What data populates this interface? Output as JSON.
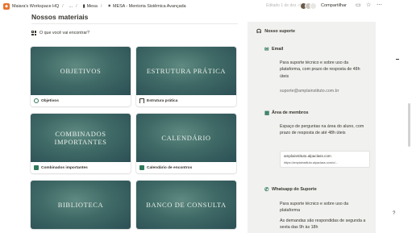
{
  "topbar": {
    "workspace_icon": "notion-workspace-icon",
    "workspace": "Maiara's Workspace HQ",
    "ellipsis": "...",
    "crumb_mesa": "Mesa",
    "crumb_mentoria": "MESA - Mentoria Sistêmica Avançada",
    "edit_info": "Editado 1 de dez. de 2024",
    "share": "Compartilhar",
    "icons": [
      "comment-icon",
      "star-icon",
      "more-icon"
    ]
  },
  "page": {
    "title": "Nossos materiais",
    "search_prompt": "O que você vai encontrar?"
  },
  "cards": [
    {
      "cover": "OBJETIVOS",
      "label": "Objetivos",
      "icon": "target-icon",
      "icon_color": "#2f7a5c"
    },
    {
      "cover": "ESTRUTURA PRÁTICA",
      "label": "Estrutura prática",
      "icon": "hierarchy-icon",
      "icon_color": "#37352f"
    },
    {
      "cover": "COMBINADOS IMPORTANTES",
      "label": "Combinados importantes",
      "icon": "flag-icon",
      "icon_color": "#2f7a5c"
    },
    {
      "cover": "CALENDÁRIO",
      "label": "Calendário de encontros",
      "icon": "calendar-icon",
      "icon_color": "#2f7a5c"
    },
    {
      "cover": "BIBLIOTECA",
      "label": "",
      "icon": "",
      "icon_color": "#2f7a5c"
    },
    {
      "cover": "BANCO DE CONSULTA",
      "label": "",
      "icon": "",
      "icon_color": "#2f7a5c"
    }
  ],
  "support": {
    "title": "Nosso suporte",
    "email": {
      "heading": "Email",
      "text": "Para suporte técnico e sobre uso da plataforma, com prazo de resposta de 48h úteis",
      "address": "suporte@amplainstituto.com.br"
    },
    "members": {
      "heading": "Área de membros",
      "text": "Espaço de perguntas na área do aluno, com prazo de resposta de até 48h úteis",
      "link_title": "amplainstituto.alpaclass.com",
      "link_url": "https://amplainstituto.alpaclass.com/c/..."
    },
    "whatsapp": {
      "heading": "Whatsapp do Suporte",
      "text": "Para suporte técnico e sobre uso da plataforma",
      "text2": "As demandas são respondidas de segunda a sexta das 9h às 18h"
    }
  },
  "help": "?",
  "colors": {
    "accent_green": "#2f7a5c",
    "cover_teal": "#3f6a66",
    "panel_bg": "#f1f1ef"
  }
}
